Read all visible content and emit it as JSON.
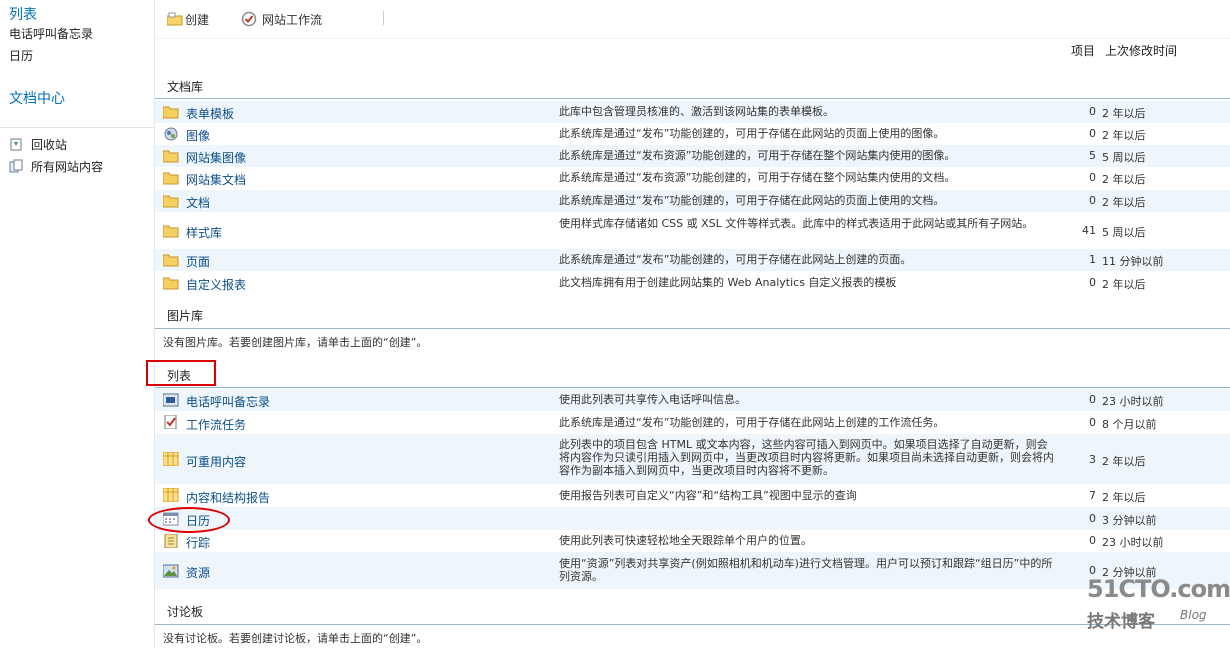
{
  "leftnav": {
    "lists_heading": "列表",
    "list_items": [
      "电话呼叫备忘录",
      "日历"
    ],
    "doc_center": "文档中心",
    "recycle_bin": "回收站",
    "all_content": "所有网站内容"
  },
  "toolbar": {
    "create_label": "创建",
    "workflow_label": "网站工作流"
  },
  "columns": {
    "items": "项目",
    "modified": "上次修改时间"
  },
  "sections": {
    "doclib": {
      "title": "文档库",
      "rows": [
        {
          "name": "表单模板",
          "desc": "此库中包含管理员核准的、激活到该网站集的表单模板。",
          "count": "0",
          "time": "2 年以后"
        },
        {
          "name": "图像",
          "desc": "此系统库是通过“发布”功能创建的，可用于存储在此网站的页面上使用的图像。",
          "count": "0",
          "time": "2 年以后"
        },
        {
          "name": "网站集图像",
          "desc": "此系统库是通过“发布资源”功能创建的，可用于存储在整个网站集内使用的图像。",
          "count": "5",
          "time": "5 周以后"
        },
        {
          "name": "网站集文档",
          "desc": "此系统库是通过“发布资源”功能创建的，可用于存储在整个网站集内使用的文档。",
          "count": "0",
          "time": "2 年以后"
        },
        {
          "name": "文档",
          "desc": "此系统库是通过“发布”功能创建的，可用于存储在此网站的页面上使用的文档。",
          "count": "0",
          "time": "2 年以后"
        },
        {
          "name": "样式库",
          "desc": "使用样式库存储诸如 CSS 或 XSL 文件等样式表。此库中的样式表适用于此网站或其所有子网站。",
          "count": "41",
          "time": "5 周以后"
        },
        {
          "name": "页面",
          "desc": "此系统库是通过“发布”功能创建的，可用于存储在此网站上创建的页面。",
          "count": "1",
          "time": "11 分钟以前"
        },
        {
          "name": "自定义报表",
          "desc": "此文档库拥有用于创建此网站集的 Web Analytics 自定义报表的模板",
          "count": "0",
          "time": "2 年以后"
        }
      ]
    },
    "piclib": {
      "title": "图片库",
      "empty": "没有图片库。若要创建图片库，请单击上面的“创建”。"
    },
    "lists": {
      "title": "列表",
      "rows": [
        {
          "name": "电话呼叫备忘录",
          "desc": "使用此列表可共享传入电话呼叫信息。",
          "count": "0",
          "time": "23 小时以前"
        },
        {
          "name": "工作流任务",
          "desc": "此系统库是通过“发布”功能创建的，可用于存储在此网站上创建的工作流任务。",
          "count": "0",
          "time": "8 个月以前"
        },
        {
          "name": "可重用内容",
          "desc": "此列表中的项目包含 HTML 或文本内容，这些内容可插入到网页中。如果项目选择了自动更新，则会将内容作为只读引用插入到网页中，当更改项目时内容将更新。如果项目尚未选择自动更新，则会将内容作为副本插入到网页中，当更改项目时内容将不更新。",
          "count": "3",
          "time": "2 年以后"
        },
        {
          "name": "内容和结构报告",
          "desc": "使用报告列表可自定义“内容”和“结构工具”视图中显示的查询",
          "count": "7",
          "time": "2 年以后"
        },
        {
          "name": "日历",
          "desc": "",
          "count": "0",
          "time": "3 分钟以前"
        },
        {
          "name": "行踪",
          "desc": "使用此列表可快速轻松地全天跟踪单个用户的位置。",
          "count": "0",
          "time": "23 小时以前"
        },
        {
          "name": "资源",
          "desc": "使用“资源”列表对共享资产(例如照相机和机动车)进行文档管理。用户可以预订和跟踪“组日历”中的所列资源。",
          "count": "0",
          "time": "2 分钟以前"
        }
      ]
    },
    "discussion": {
      "title": "讨论板",
      "empty": "没有讨论板。若要创建讨论板，请单击上面的“创建”。"
    }
  },
  "watermark": {
    "site": "51CTO.com",
    "sub": "技术博客",
    "blog": "Blog"
  },
  "colors": {
    "link": "#0b4f8a",
    "nav_heading": "#0072bc",
    "alt_row": "#eef5fb",
    "annotation": "#dd0000"
  }
}
